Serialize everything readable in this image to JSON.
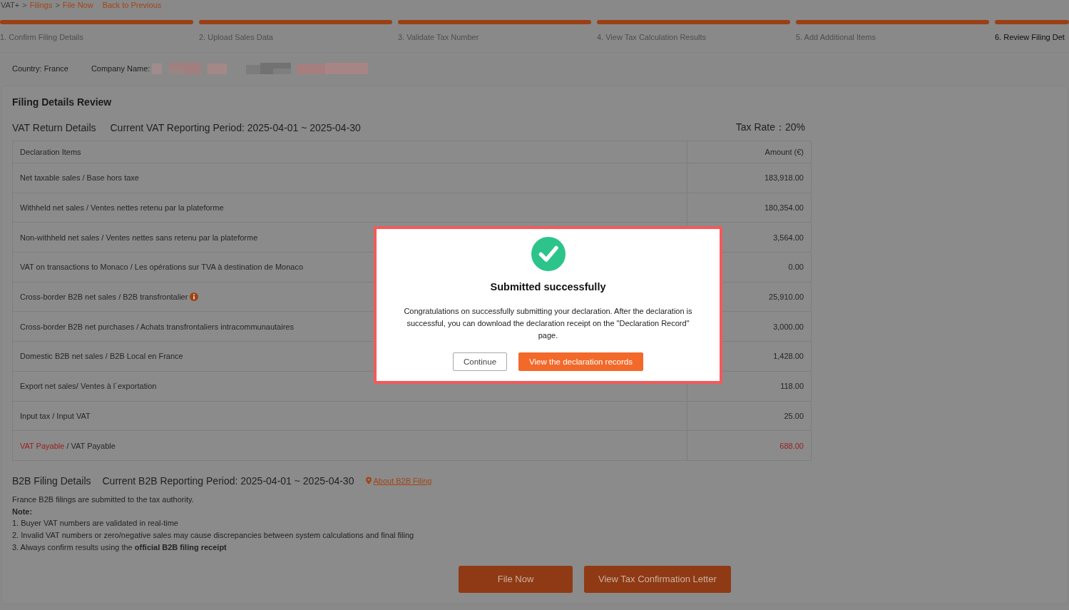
{
  "breadcrumb": {
    "items": [
      {
        "label": "VAT+",
        "kind": "root",
        "separator": ">"
      },
      {
        "label": "Filings",
        "kind": "link",
        "separator": ">"
      },
      {
        "label": "File Now",
        "kind": "link"
      }
    ],
    "back_link": "Back to Previous"
  },
  "steps": [
    {
      "label": "1. Confirm Filing Details",
      "completed": true,
      "selected": false
    },
    {
      "label": "2. Upload Sales Data",
      "completed": true,
      "selected": false
    },
    {
      "label": "3. Validate Tax Number",
      "completed": true,
      "selected": false
    },
    {
      "label": "4. View Tax Calculation Results",
      "completed": true,
      "selected": false
    },
    {
      "label": "5. Add Additional Items",
      "completed": true,
      "selected": false
    },
    {
      "label": "6. Review Filing Det",
      "completed": true,
      "selected": true
    }
  ],
  "filing_info": {
    "country": "Country: France",
    "company_name_label": "Company Name:",
    "company_name_redacted": true
  },
  "review": {
    "title": "Filing Details Review",
    "vat_section": {
      "title": "VAT Return Details",
      "period": "Current VAT Reporting Period: 2025-04-01 ~ 2025-04-30",
      "tax_rate": "Tax Rate：20%"
    },
    "table": {
      "columns": [
        "Declaration Items",
        "Amount (€)"
      ],
      "rows": [
        {
          "kind": "normal",
          "item": "Net taxable sales / Base hors taxe",
          "amount": "183,918.00"
        },
        {
          "kind": "normal",
          "item": "Withheld net sales / Ventes nettes retenu par la plateforme",
          "amount": "180,354.00"
        },
        {
          "kind": "normal",
          "item": "Non-withheld net sales / Ventes nettes sans retenu par la plateforme",
          "amount": "3,564.00"
        },
        {
          "kind": "normal",
          "item": "VAT on transactions to Monaco / Les opérations sur TVA à destination de Monaco",
          "amount": "0.00"
        },
        {
          "kind": "info",
          "item": "Cross-border B2B net sales / B2B transfrontalier",
          "amount": "25,910.00"
        },
        {
          "kind": "normal",
          "item": "Cross-border B2B net purchases / Achats transfrontaliers intracommunautaires",
          "amount": "3,000.00"
        },
        {
          "kind": "normal",
          "item": "Domestic B2B net sales / B2B Local en France",
          "amount": "1,428.00"
        },
        {
          "kind": "normal",
          "item": "Export net sales/ Ventes à l´exportation",
          "amount": "118.00"
        },
        {
          "kind": "normal",
          "item": "Input tax / Input VAT",
          "amount": "25.00"
        },
        {
          "kind": "payable",
          "item_highlight": "VAT Payable",
          "item": "/ VAT Payable",
          "amount": "688.00"
        }
      ]
    },
    "b2b_section": {
      "title": "B2B Filing Details",
      "period": "Current B2B Reporting Period: 2025-04-01 ~ 2025-04-30",
      "link": "About B2B Filing",
      "intro": "France B2B filings are submitted to the tax authority.",
      "note_label": "Note:",
      "notes": [
        "1. Buyer VAT numbers are validated in real-time",
        "2. Invalid VAT numbers or zero/negative sales may cause discrepancies between system calculations and final filing",
        "3. Always confirm results using the **official B2B filing receipt**"
      ]
    },
    "buttons": [
      {
        "label": "File Now",
        "kind": "primary"
      },
      {
        "label": "View Tax Confirmation Letter",
        "kind": "primary"
      }
    ]
  },
  "dialog": {
    "title": "Submitted successfully",
    "message": "Congratulations on successfully submitting your declaration. After the declaration is successful, you can download the declaration receipt on the \"Declaration Record\" page.",
    "buttons": [
      {
        "label": "Continue",
        "kind": "secondary"
      },
      {
        "label": "View the declaration records",
        "kind": "primary"
      }
    ]
  }
}
